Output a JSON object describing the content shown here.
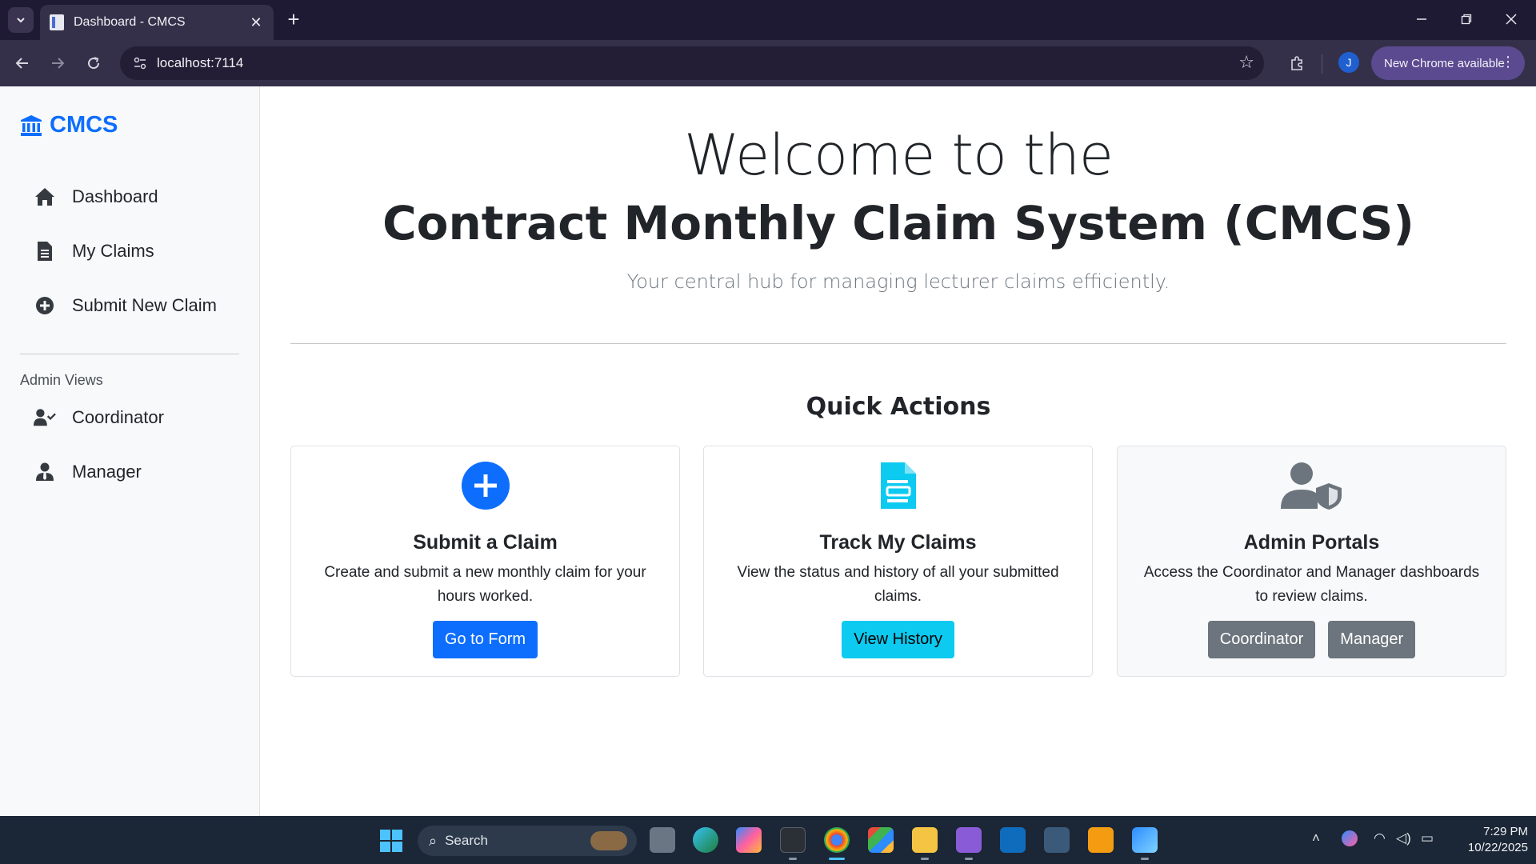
{
  "browser": {
    "tab_title": "Dashboard - CMCS",
    "url": "localhost:7114",
    "profile_initial": "J",
    "new_chrome_label": "New Chrome available"
  },
  "sidebar": {
    "brand": "CMCS",
    "items": [
      {
        "label": "Dashboard",
        "icon": "home-icon"
      },
      {
        "label": "My Claims",
        "icon": "file-icon"
      },
      {
        "label": "Submit New Claim",
        "icon": "plus-circle-icon"
      }
    ],
    "admin_heading": "Admin Views",
    "admin_items": [
      {
        "label": "Coordinator",
        "icon": "user-check-icon"
      },
      {
        "label": "Manager",
        "icon": "user-tie-icon"
      }
    ]
  },
  "main": {
    "welcome": "Welcome to the",
    "title": "Contract Monthly Claim System (CMCS)",
    "lead": "Your central hub for managing lecturer claims efficiently.",
    "quick_actions_title": "Quick Actions",
    "cards": [
      {
        "title": "Submit a Claim",
        "text": "Create and submit a new monthly claim for your hours worked.",
        "buttons": [
          "Go to Form"
        ]
      },
      {
        "title": "Track My Claims",
        "text": "View the status and history of all your submitted claims.",
        "buttons": [
          "View History"
        ]
      },
      {
        "title": "Admin Portals",
        "text": "Access the Coordinator and Manager dashboards to review claims.",
        "buttons": [
          "Coordinator",
          "Manager"
        ]
      }
    ]
  },
  "colors": {
    "primary": "#0d6efd",
    "info": "#0dcaf0",
    "secondary": "#6c757d"
  },
  "taskbar": {
    "search_label": "Search",
    "time": "7:29 PM",
    "date": "10/22/2025"
  }
}
